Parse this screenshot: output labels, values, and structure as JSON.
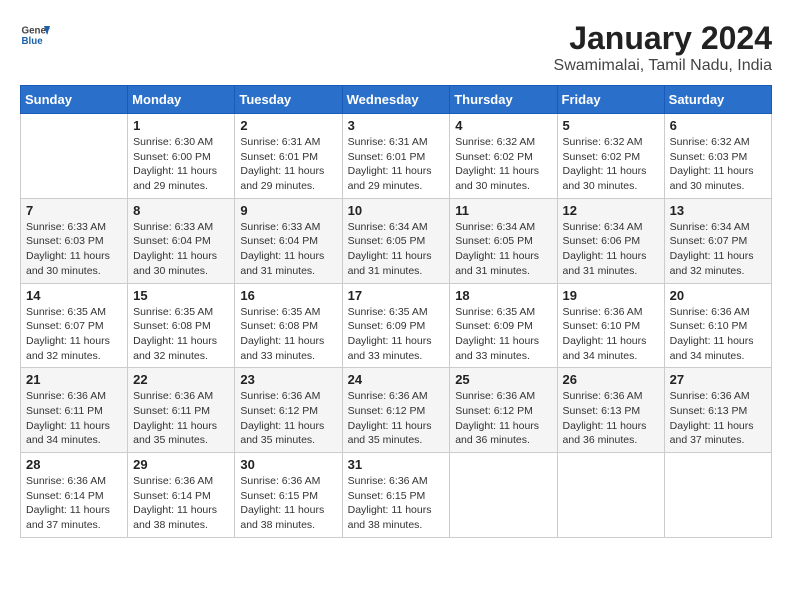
{
  "header": {
    "logo_general": "General",
    "logo_blue": "Blue",
    "title": "January 2024",
    "subtitle": "Swamimalai, Tamil Nadu, India"
  },
  "weekdays": [
    "Sunday",
    "Monday",
    "Tuesday",
    "Wednesday",
    "Thursday",
    "Friday",
    "Saturday"
  ],
  "weeks": [
    [
      {
        "day": "",
        "info": ""
      },
      {
        "day": "1",
        "info": "Sunrise: 6:30 AM\nSunset: 6:00 PM\nDaylight: 11 hours\nand 29 minutes."
      },
      {
        "day": "2",
        "info": "Sunrise: 6:31 AM\nSunset: 6:01 PM\nDaylight: 11 hours\nand 29 minutes."
      },
      {
        "day": "3",
        "info": "Sunrise: 6:31 AM\nSunset: 6:01 PM\nDaylight: 11 hours\nand 29 minutes."
      },
      {
        "day": "4",
        "info": "Sunrise: 6:32 AM\nSunset: 6:02 PM\nDaylight: 11 hours\nand 30 minutes."
      },
      {
        "day": "5",
        "info": "Sunrise: 6:32 AM\nSunset: 6:02 PM\nDaylight: 11 hours\nand 30 minutes."
      },
      {
        "day": "6",
        "info": "Sunrise: 6:32 AM\nSunset: 6:03 PM\nDaylight: 11 hours\nand 30 minutes."
      }
    ],
    [
      {
        "day": "7",
        "info": "Sunrise: 6:33 AM\nSunset: 6:03 PM\nDaylight: 11 hours\nand 30 minutes."
      },
      {
        "day": "8",
        "info": "Sunrise: 6:33 AM\nSunset: 6:04 PM\nDaylight: 11 hours\nand 30 minutes."
      },
      {
        "day": "9",
        "info": "Sunrise: 6:33 AM\nSunset: 6:04 PM\nDaylight: 11 hours\nand 31 minutes."
      },
      {
        "day": "10",
        "info": "Sunrise: 6:34 AM\nSunset: 6:05 PM\nDaylight: 11 hours\nand 31 minutes."
      },
      {
        "day": "11",
        "info": "Sunrise: 6:34 AM\nSunset: 6:05 PM\nDaylight: 11 hours\nand 31 minutes."
      },
      {
        "day": "12",
        "info": "Sunrise: 6:34 AM\nSunset: 6:06 PM\nDaylight: 11 hours\nand 31 minutes."
      },
      {
        "day": "13",
        "info": "Sunrise: 6:34 AM\nSunset: 6:07 PM\nDaylight: 11 hours\nand 32 minutes."
      }
    ],
    [
      {
        "day": "14",
        "info": "Sunrise: 6:35 AM\nSunset: 6:07 PM\nDaylight: 11 hours\nand 32 minutes."
      },
      {
        "day": "15",
        "info": "Sunrise: 6:35 AM\nSunset: 6:08 PM\nDaylight: 11 hours\nand 32 minutes."
      },
      {
        "day": "16",
        "info": "Sunrise: 6:35 AM\nSunset: 6:08 PM\nDaylight: 11 hours\nand 33 minutes."
      },
      {
        "day": "17",
        "info": "Sunrise: 6:35 AM\nSunset: 6:09 PM\nDaylight: 11 hours\nand 33 minutes."
      },
      {
        "day": "18",
        "info": "Sunrise: 6:35 AM\nSunset: 6:09 PM\nDaylight: 11 hours\nand 33 minutes."
      },
      {
        "day": "19",
        "info": "Sunrise: 6:36 AM\nSunset: 6:10 PM\nDaylight: 11 hours\nand 34 minutes."
      },
      {
        "day": "20",
        "info": "Sunrise: 6:36 AM\nSunset: 6:10 PM\nDaylight: 11 hours\nand 34 minutes."
      }
    ],
    [
      {
        "day": "21",
        "info": "Sunrise: 6:36 AM\nSunset: 6:11 PM\nDaylight: 11 hours\nand 34 minutes."
      },
      {
        "day": "22",
        "info": "Sunrise: 6:36 AM\nSunset: 6:11 PM\nDaylight: 11 hours\nand 35 minutes."
      },
      {
        "day": "23",
        "info": "Sunrise: 6:36 AM\nSunset: 6:12 PM\nDaylight: 11 hours\nand 35 minutes."
      },
      {
        "day": "24",
        "info": "Sunrise: 6:36 AM\nSunset: 6:12 PM\nDaylight: 11 hours\nand 35 minutes."
      },
      {
        "day": "25",
        "info": "Sunrise: 6:36 AM\nSunset: 6:12 PM\nDaylight: 11 hours\nand 36 minutes."
      },
      {
        "day": "26",
        "info": "Sunrise: 6:36 AM\nSunset: 6:13 PM\nDaylight: 11 hours\nand 36 minutes."
      },
      {
        "day": "27",
        "info": "Sunrise: 6:36 AM\nSunset: 6:13 PM\nDaylight: 11 hours\nand 37 minutes."
      }
    ],
    [
      {
        "day": "28",
        "info": "Sunrise: 6:36 AM\nSunset: 6:14 PM\nDaylight: 11 hours\nand 37 minutes."
      },
      {
        "day": "29",
        "info": "Sunrise: 6:36 AM\nSunset: 6:14 PM\nDaylight: 11 hours\nand 38 minutes."
      },
      {
        "day": "30",
        "info": "Sunrise: 6:36 AM\nSunset: 6:15 PM\nDaylight: 11 hours\nand 38 minutes."
      },
      {
        "day": "31",
        "info": "Sunrise: 6:36 AM\nSunset: 6:15 PM\nDaylight: 11 hours\nand 38 minutes."
      },
      {
        "day": "",
        "info": ""
      },
      {
        "day": "",
        "info": ""
      },
      {
        "day": "",
        "info": ""
      }
    ]
  ]
}
